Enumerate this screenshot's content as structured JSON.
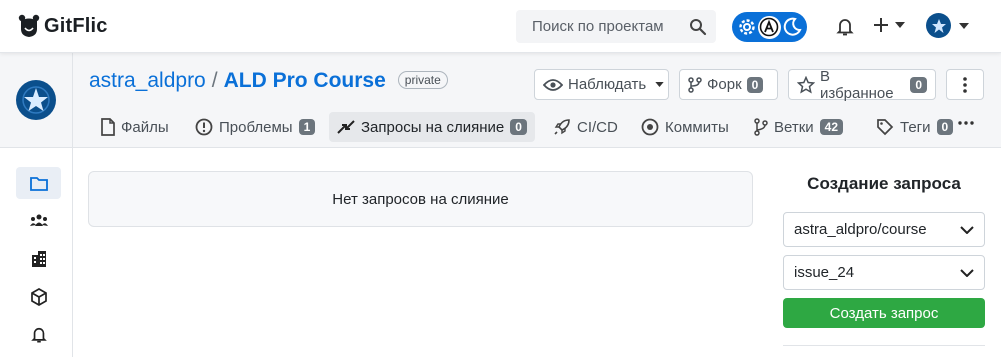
{
  "header": {
    "brand": "GitFlic",
    "search_placeholder": "Поиск по проектам",
    "icons": [
      "bear-logo-icon",
      "search-icon",
      "gear-icon",
      "accessibility-icon",
      "moon-icon",
      "bell-icon",
      "plus-icon",
      "user-avatar"
    ]
  },
  "project": {
    "owner": "astra_aldpro",
    "separator": "/",
    "repo": "ALD Pro Course",
    "visibility": "private",
    "watch_label": "Наблюдать",
    "fork_label": "Форк",
    "fork_count": "0",
    "star_label": "В избранное",
    "star_count": "0"
  },
  "tabs": [
    {
      "label": "Файлы",
      "icon": "file-icon"
    },
    {
      "label": "Проблемы",
      "count": "1",
      "icon": "issue-icon"
    },
    {
      "label": "Запросы на слияние",
      "count": "0",
      "icon": "merge-icon",
      "active": true
    },
    {
      "label": "CI/CD",
      "icon": "rocket-icon"
    },
    {
      "label": "Коммиты",
      "icon": "commit-icon"
    },
    {
      "label": "Ветки",
      "count": "42",
      "icon": "branch-icon"
    },
    {
      "label": "Теги",
      "count": "0",
      "icon": "tag-icon"
    }
  ],
  "rail": [
    "folder-icon",
    "team-icon",
    "buildings-icon",
    "package-icon",
    "bell-icon"
  ],
  "main": {
    "empty_message": "Нет запросов на слияние"
  },
  "sidebar": {
    "title": "Создание запроса",
    "source_repo": "astra_aldpro/course",
    "source_branch": "issue_24",
    "create_label": "Создать запрос"
  },
  "colors": {
    "accent": "#0a70d8",
    "success": "#2ea843",
    "badge": "#6c757d"
  }
}
